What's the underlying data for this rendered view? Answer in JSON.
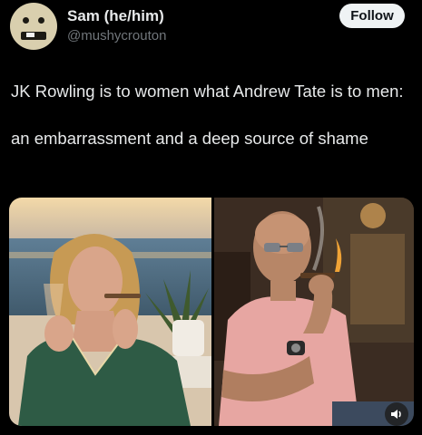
{
  "author": {
    "display_name": "Sam (he/him)",
    "handle": "@mushycrouton"
  },
  "follow_button": {
    "label": "Follow"
  },
  "tweet": {
    "line1": "JK Rowling is to women what Andrew Tate is to men:",
    "line2": "an embarrassment and a deep source of shame"
  },
  "media": {
    "photos": [
      {
        "description": "woman-smoking-cigar-by-sea"
      },
      {
        "description": "bald-man-smoking-cigar-in-pink-shirt"
      }
    ],
    "sound_icon": "speaker-icon"
  },
  "colors": {
    "background": "#000000",
    "text": "#e7e9ea",
    "muted": "#71767b",
    "follow_bg": "#eff3f4",
    "follow_text": "#0f1419"
  }
}
